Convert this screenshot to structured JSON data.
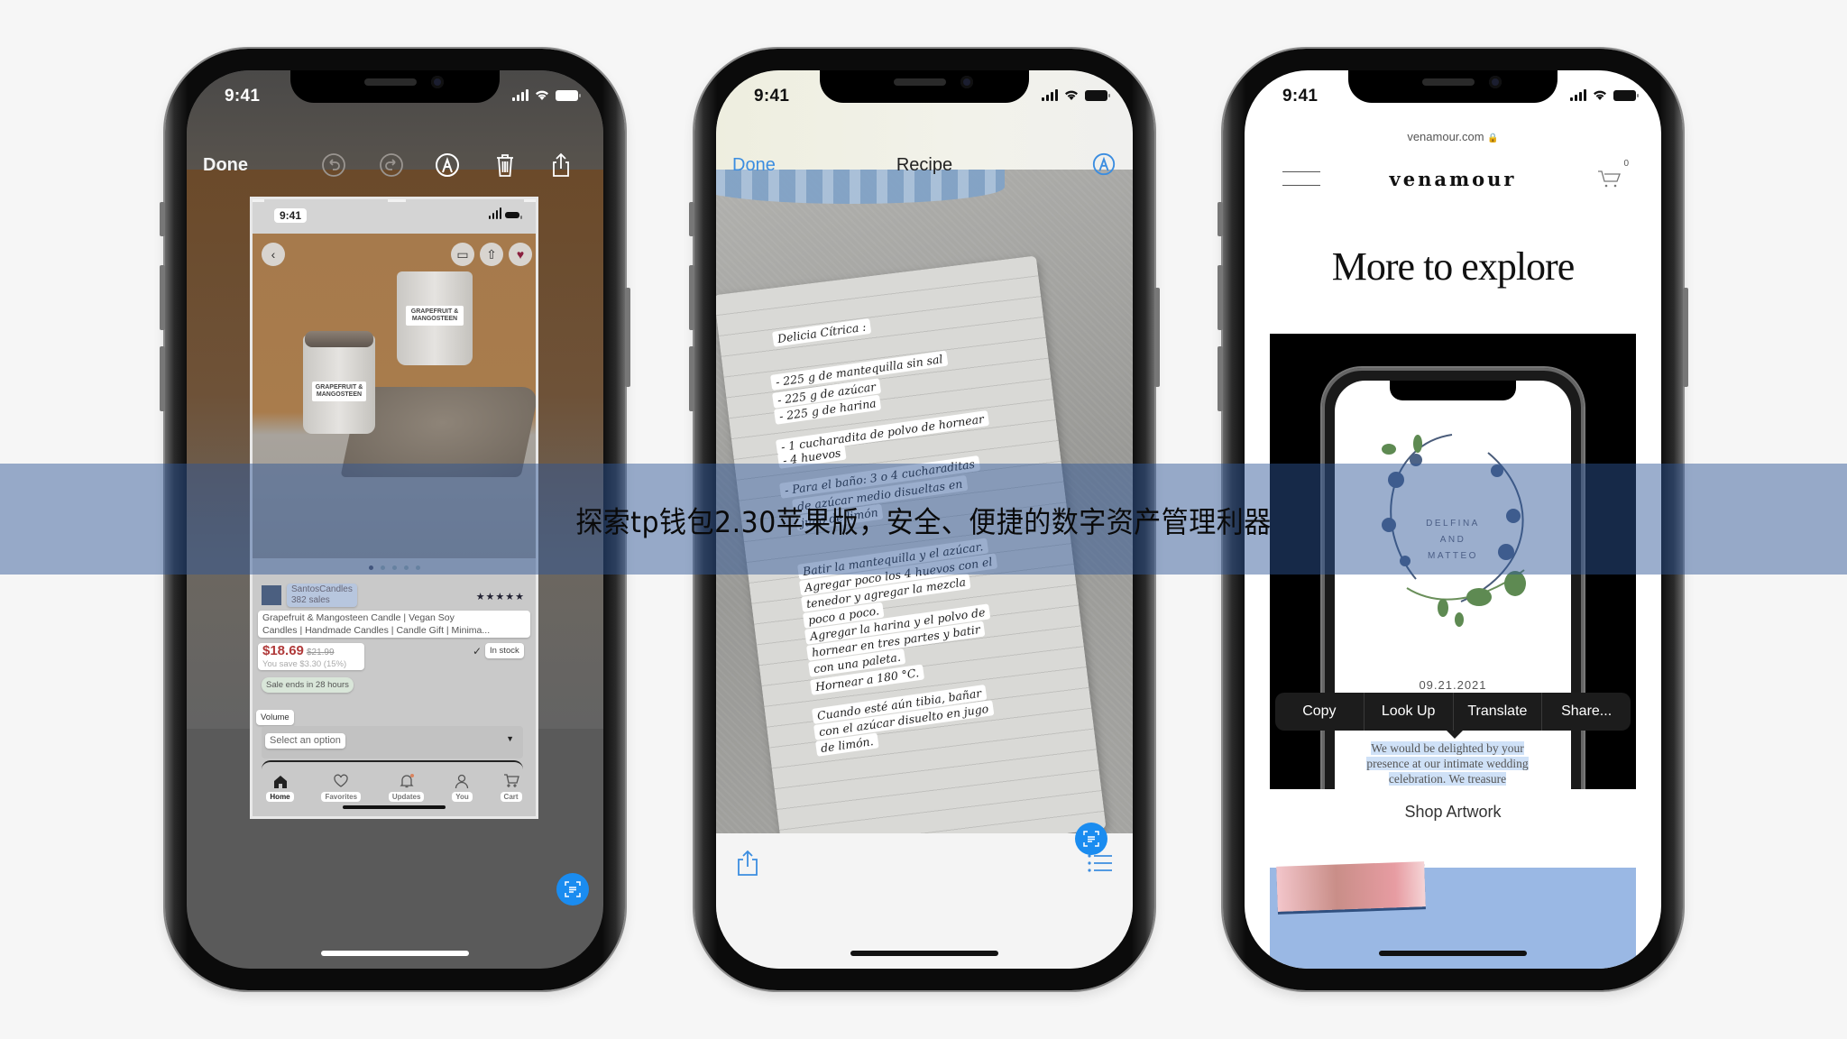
{
  "overlay": {
    "caption": "探索tp钱包2.30苹果版，安全、便捷的数字资产管理利器",
    "band_color": "#8fa4c3"
  },
  "phones": [
    {
      "id": "markup",
      "status_time": "9:41",
      "nav": {
        "done_label": "Done",
        "tools": [
          "undo-icon",
          "redo-icon",
          "markup-pen-icon",
          "trash-icon",
          "share-icon"
        ]
      },
      "screenshot": {
        "status_time": "9:41",
        "top_actions": [
          "back-icon",
          "message-icon",
          "share-icon",
          "heart-icon"
        ],
        "candle_labels": [
          "GRAPEFRUIT & MANGOSTEEN",
          "GRAPEFRUIT & MANGOSTEEN"
        ],
        "carousel": {
          "count": 5,
          "active": 1
        },
        "shop": {
          "name": "SantosCandles",
          "sales": "382 sales",
          "rating": 5,
          "stars": "★★★★★"
        },
        "product_title": [
          "Grapefruit & Mangosteen Candle | Vegan Soy",
          "Candles | Handmade Candles | Candle Gift | Minima..."
        ],
        "price": "$18.69",
        "original_price": "$21.99",
        "savings": "You save $3.30 (15%)",
        "sale_note": "Sale ends in 28 hours",
        "stock": "In stock",
        "volume_label": "Volume",
        "volume_placeholder": "Select an option",
        "tabs": [
          {
            "label": "Home",
            "icon": "home-icon",
            "active": true
          },
          {
            "label": "Favorites",
            "icon": "heart-outline-icon"
          },
          {
            "label": "Updates",
            "icon": "bell-icon",
            "badge": true
          },
          {
            "label": "You",
            "icon": "person-icon"
          },
          {
            "label": "Cart",
            "icon": "cart-icon"
          }
        ]
      },
      "live_text_button": "live-text-icon",
      "accent": "#1a8cf0"
    },
    {
      "id": "recipe",
      "status_time": "9:41",
      "nav": {
        "done_label": "Done",
        "title": "Recipe",
        "right_icon": "markup-pen-icon"
      },
      "handwriting": [
        "Delicia Cítrica :",
        "- 225 g de mantequilla sin sal",
        "- 225 g de azúcar",
        "- 225 g de harina",
        "- 1 cucharadita de polvo de hornear",
        "- 4 huevos",
        "- Para el baño: 3 o 4 cucharaditas",
        "de azúcar medio disueltas en",
        "jugo de limón",
        "Batir la mantequilla y el azúcar.",
        "Agregar poco los 4 huevos con el",
        "tenedor y agregar la mezcla",
        "poco a poco.",
        "Agregar la harina y el polvo de",
        "hornear en tres partes y batir",
        "con una paleta.",
        "Hornear a 180 °C.",
        "Cuando esté aún tibia, bañar",
        "con el azúcar disuelto en jugo",
        "de limón."
      ],
      "toolbar": [
        "share-icon",
        "list-icon"
      ],
      "accent": "#3b8de0"
    },
    {
      "id": "venamour",
      "status_time": "9:41",
      "url": "venamour.com",
      "brand": "venamour",
      "cart_count": "0",
      "heading": "More to explore",
      "invitation": {
        "names": [
          "DELFINA",
          "AND",
          "MATTEO"
        ],
        "date": "09.21.2021",
        "selected_text": "We would be delighted by your presence at our intimate wedding celebration. We treasure"
      },
      "context_menu": [
        "Copy",
        "Look Up",
        "Translate",
        "Share..."
      ],
      "shop_link": "Shop Artwork"
    }
  ]
}
